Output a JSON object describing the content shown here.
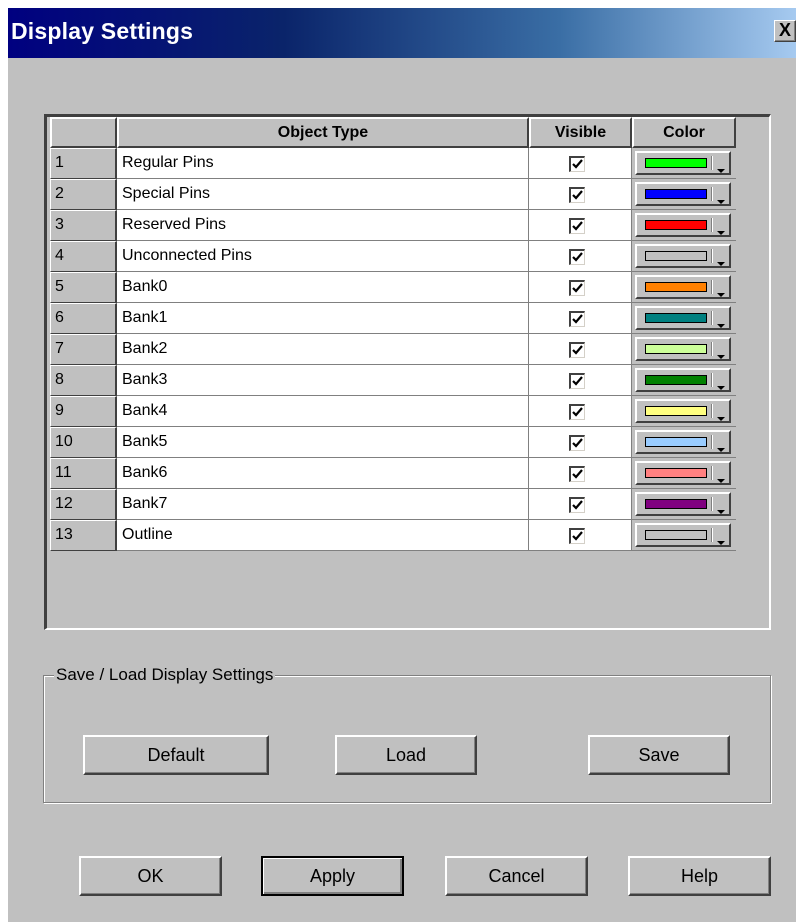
{
  "window": {
    "title": "Display Settings",
    "close_label": "X"
  },
  "grid": {
    "headers": {
      "number": "",
      "object_type": "Object Type",
      "visible": "Visible",
      "color": "Color"
    },
    "rows": [
      {
        "num": "1",
        "name": "Regular Pins",
        "visible": true,
        "color": "#00ff00"
      },
      {
        "num": "2",
        "name": "Special Pins",
        "visible": true,
        "color": "#0000ff"
      },
      {
        "num": "3",
        "name": "Reserved Pins",
        "visible": true,
        "color": "#ff0000"
      },
      {
        "num": "4",
        "name": "Unconnected Pins",
        "visible": true,
        "color": "#c0c0c0"
      },
      {
        "num": "5",
        "name": "Bank0",
        "visible": true,
        "color": "#ff8000"
      },
      {
        "num": "6",
        "name": "Bank1",
        "visible": true,
        "color": "#008080"
      },
      {
        "num": "7",
        "name": "Bank2",
        "visible": true,
        "color": "#ccff99"
      },
      {
        "num": "8",
        "name": "Bank3",
        "visible": true,
        "color": "#008000"
      },
      {
        "num": "9",
        "name": "Bank4",
        "visible": true,
        "color": "#ffff80"
      },
      {
        "num": "10",
        "name": "Bank5",
        "visible": true,
        "color": "#99ccff"
      },
      {
        "num": "11",
        "name": "Bank6",
        "visible": true,
        "color": "#ff8080"
      },
      {
        "num": "12",
        "name": "Bank7",
        "visible": true,
        "color": "#800080"
      },
      {
        "num": "13",
        "name": "Outline",
        "visible": true,
        "color": "#c0c0c0"
      }
    ]
  },
  "save_load": {
    "group_label": "Save / Load Display Settings",
    "default_label": "Default",
    "load_label": "Load",
    "save_label": "Save"
  },
  "footer": {
    "ok_label": "OK",
    "apply_label": "Apply",
    "cancel_label": "Cancel",
    "help_label": "Help"
  }
}
